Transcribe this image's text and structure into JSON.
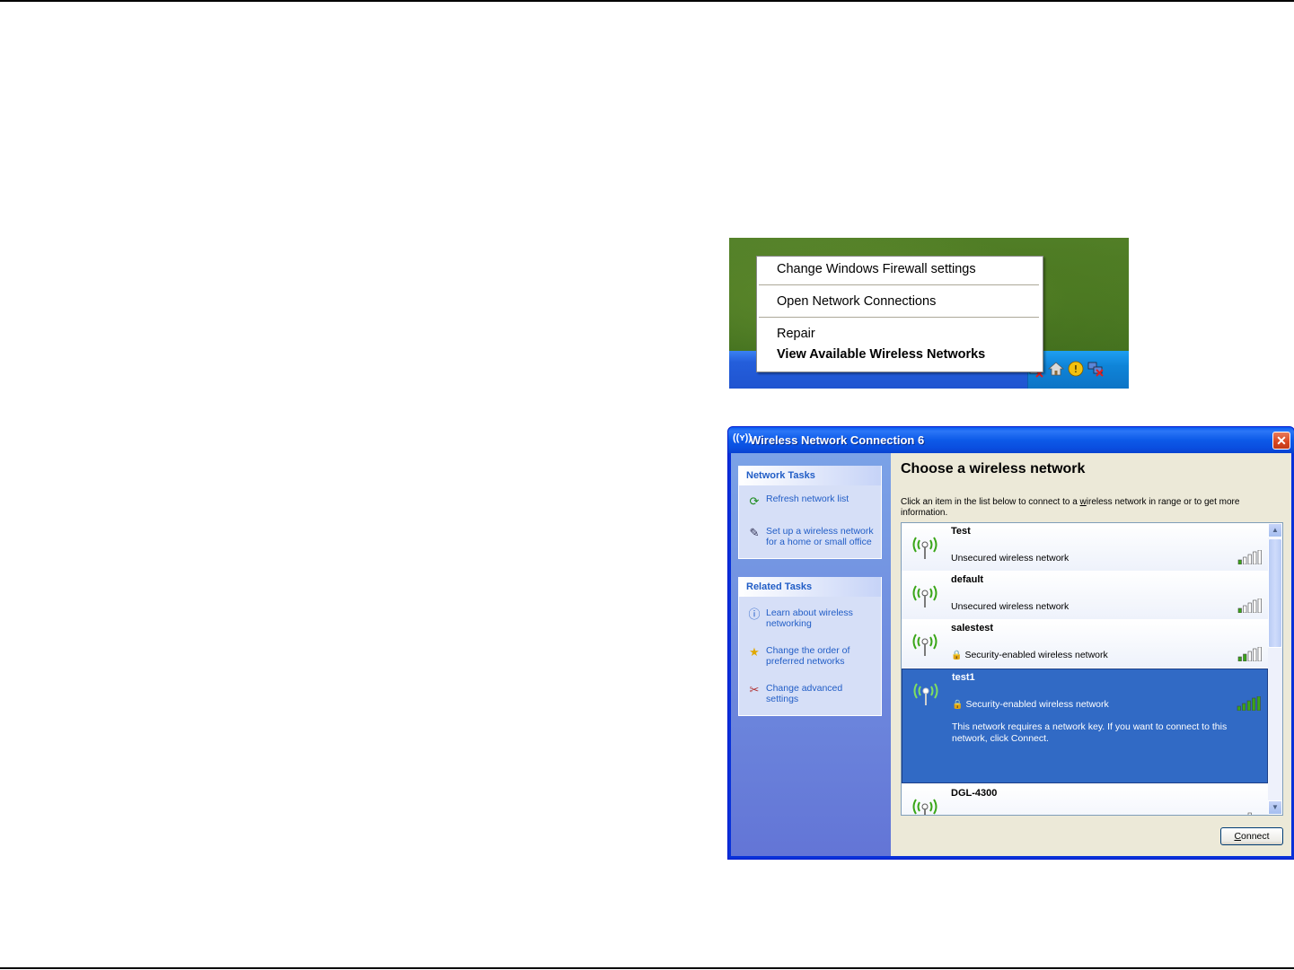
{
  "context_menu": {
    "items": [
      {
        "label": "Change Windows Firewall settings",
        "bold": false
      },
      {
        "label": "Open Network Connections",
        "bold": false
      },
      {
        "label": "Repair",
        "bold": false
      },
      {
        "label": "View Available Wireless Networks",
        "bold": true
      }
    ],
    "tray_icons": [
      "wireless-disconnected-icon",
      "home-icon",
      "security-center-icon",
      "network-disconnected-icon"
    ]
  },
  "dialog": {
    "title": "Wireless Network Connection 6",
    "close_label": "✕",
    "network_tasks": {
      "header": "Network Tasks",
      "items": [
        {
          "label": "Refresh network list",
          "icon": "refresh-icon"
        },
        {
          "label": "Set up a wireless network for a home or small office",
          "icon": "wireless-setup-icon"
        }
      ]
    },
    "related_tasks": {
      "header": "Related Tasks",
      "items": [
        {
          "label": "Learn about wireless networking",
          "icon": "info-icon"
        },
        {
          "label": "Change the order of preferred networks",
          "icon": "star-icon"
        },
        {
          "label": "Change advanced settings",
          "icon": "tools-icon"
        }
      ]
    },
    "heading": "Choose a wireless network",
    "instructions": {
      "before": "Click an item in the list below to connect to a ",
      "underlined": "w",
      "after": "ireless network in range or to get more information."
    },
    "networks": [
      {
        "ssid": "Test",
        "status": "Unsecured wireless network",
        "secured": false,
        "signal_bars": 1,
        "selected": false
      },
      {
        "ssid": "default",
        "status": "Unsecured wireless network",
        "secured": false,
        "signal_bars": 1,
        "selected": false
      },
      {
        "ssid": "salestest",
        "status": "Security-enabled wireless network",
        "secured": true,
        "signal_bars": 2,
        "selected": false
      },
      {
        "ssid": "test1",
        "status": "Security-enabled wireless network",
        "secured": true,
        "signal_bars": 5,
        "selected": true,
        "description": "This network requires a network key. If you want to connect to this network, click Connect."
      },
      {
        "ssid": "DGL-4300",
        "status": "",
        "secured": false,
        "signal_bars": 1,
        "selected": false
      }
    ],
    "connect_button": {
      "underlined": "C",
      "rest": "onnect"
    }
  },
  "colors": {
    "xp_blue": "#0a4ee0",
    "task_link": "#215dc6",
    "selection": "#316ac5",
    "signal_on": "#3aa618",
    "signal_off": "#ffffff"
  }
}
